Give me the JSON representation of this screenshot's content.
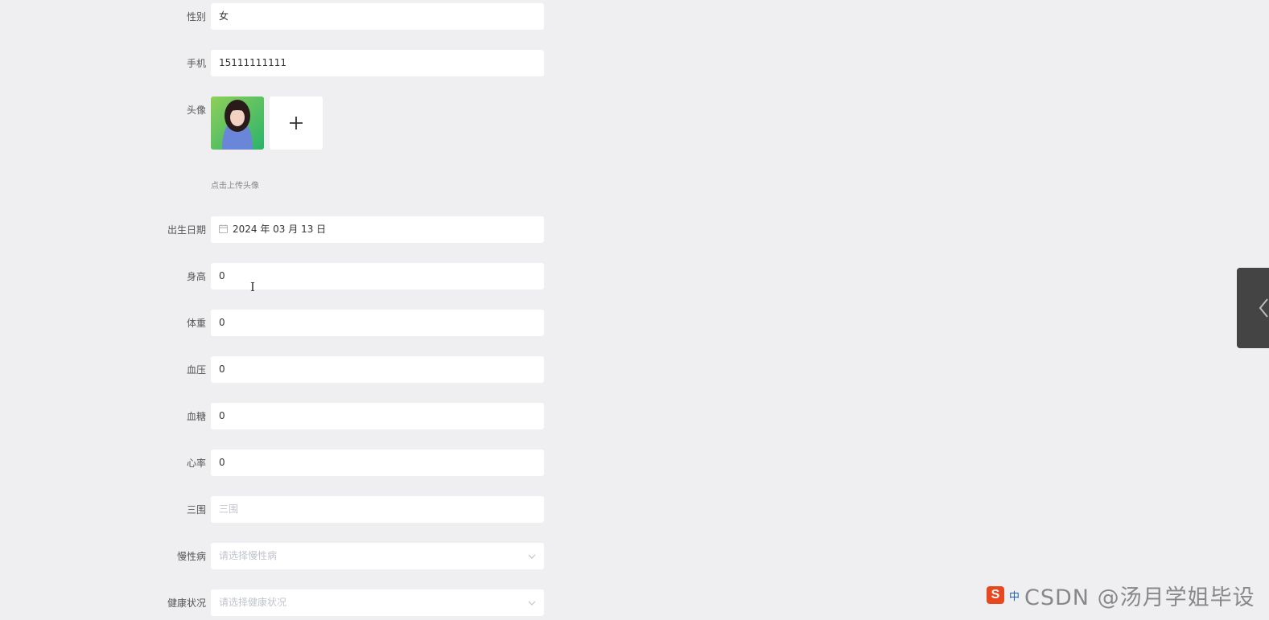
{
  "form": {
    "gender": {
      "label": "性别",
      "value": "女"
    },
    "phone": {
      "label": "手机",
      "value": "15111111111"
    },
    "avatar": {
      "label": "头像",
      "hint": "点击上传头像"
    },
    "birthday": {
      "label": "出生日期",
      "value": "2024 年 03 月 13 日"
    },
    "height": {
      "label": "身高",
      "value": "0"
    },
    "weight": {
      "label": "体重",
      "value": "0"
    },
    "blood_pressure": {
      "label": "血压",
      "value": "0"
    },
    "blood_sugar": {
      "label": "血糖",
      "value": "0"
    },
    "heart_rate": {
      "label": "心率",
      "value": "0"
    },
    "measurements": {
      "label": "三围",
      "placeholder": "三围"
    },
    "chronic_disease": {
      "label": "慢性病",
      "placeholder": "请选择慢性病"
    },
    "health_status": {
      "label": "健康状况",
      "placeholder": "请选择健康状况"
    }
  },
  "watermark": {
    "text": "CSDN @汤月学姐毕设",
    "logo_letter": "S",
    "ime_label": "中"
  },
  "icons": {
    "calendar": "calendar-icon",
    "plus": "plus-icon",
    "chevron": "chevron-down-icon",
    "side_toggle": "chevron-left-icon"
  },
  "colors": {
    "page_bg": "#efeff1",
    "field_bg": "#ffffff",
    "side_tab": "#444444",
    "logo": "#e8481f"
  }
}
